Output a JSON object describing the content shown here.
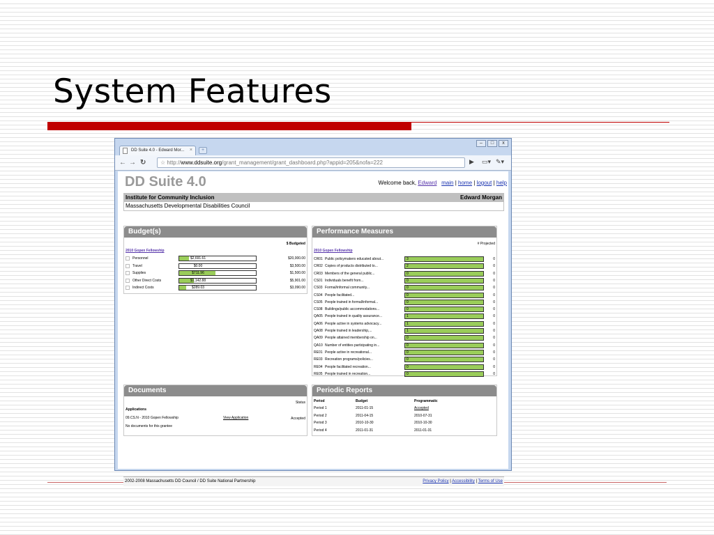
{
  "slide": {
    "title": "System Features"
  },
  "browser": {
    "tab_title": "DD Suite 4.0 - Edward Mor...",
    "tab_close": "×",
    "new_tab": "+",
    "url_prefix": "http://",
    "url_host": "www.ddsuite.org",
    "url_path": "/grant_management/grant_dashboard.php?appid=205&nofa=222",
    "window_buttons": [
      "–",
      "□",
      "x"
    ]
  },
  "header": {
    "logo": "DD Suite 4.0",
    "welcome": "Welcome back,",
    "user": "Edward",
    "links": [
      "main",
      "home",
      "logout",
      "help"
    ],
    "org_name": "Institute for Community Inclusion",
    "org_user": "Edward Morgan",
    "council": "Massachusetts Developmental Disabilities Council"
  },
  "budget": {
    "title": "Budget(s)",
    "column_label": "$ Budgeted",
    "grant": "2010 Gopen Fellowship",
    "rows": [
      {
        "name": "Personnel",
        "spent": "$2,691.61",
        "ratio": 0.13,
        "budgeted": "$20,000.00"
      },
      {
        "name": "Travel",
        "spent": "$0.00",
        "ratio": 0,
        "budgeted": "$3,500.00"
      },
      {
        "name": "Supplies",
        "spent": "$711.96",
        "ratio": 0.47,
        "budgeted": "$1,500.00"
      },
      {
        "name": "Other Direct Costs",
        "spent": "$1,142.88",
        "ratio": 0.19,
        "budgeted": "$5,901.00"
      },
      {
        "name": "Indirect Costs",
        "spent": "$289.03",
        "ratio": 0.09,
        "budgeted": "$3,090.00"
      }
    ]
  },
  "performance": {
    "title": "Performance Measures",
    "column_label": "# Projected",
    "grant": "2010 Gopen Fellowship",
    "rows": [
      {
        "code": "CR01",
        "desc": "Public policymakers educated about...",
        "value": "3",
        "projected": "0"
      },
      {
        "code": "CR02",
        "desc": "Copies of products distributed to...",
        "value": "2",
        "projected": "0"
      },
      {
        "code": "CR03",
        "desc": "Members of the general public...",
        "value": "0",
        "projected": "0"
      },
      {
        "code": "CS01",
        "desc": "Individuals benefit from...",
        "value": "0",
        "projected": "0"
      },
      {
        "code": "CS03",
        "desc": "Formal/informal community...",
        "value": "0",
        "projected": "0"
      },
      {
        "code": "CS04",
        "desc": "People facilitated...",
        "value": "0",
        "projected": "0"
      },
      {
        "code": "CS05",
        "desc": "People trained in formal/informal...",
        "value": "0",
        "projected": "0"
      },
      {
        "code": "CS08",
        "desc": "Buildings/public accommodations...",
        "value": "0",
        "projected": "0"
      },
      {
        "code": "QA05",
        "desc": "People trained in quality assurance...",
        "value": "1",
        "projected": "0"
      },
      {
        "code": "QA06",
        "desc": "People active in systems advocacy...",
        "value": "1",
        "projected": "0"
      },
      {
        "code": "QA08",
        "desc": "People trained in leadership,...",
        "value": "1",
        "projected": "0"
      },
      {
        "code": "QA09",
        "desc": "People attained membership on...",
        "value": "0",
        "projected": "0"
      },
      {
        "code": "QA10",
        "desc": "Number of entities participating in...",
        "value": "0",
        "projected": "0"
      },
      {
        "code": "RE01",
        "desc": "People active in recreational...",
        "value": "0",
        "projected": "0"
      },
      {
        "code": "RE03",
        "desc": "Recreation programs/policies...",
        "value": "0",
        "projected": "0"
      },
      {
        "code": "RE04",
        "desc": "People facilitated recreation...",
        "value": "0",
        "projected": "0"
      },
      {
        "code": "RE05",
        "desc": "People trained in recreation...",
        "value": "0",
        "projected": "0"
      }
    ]
  },
  "documents": {
    "title": "Documents",
    "status_label": "Status",
    "section": "Applications",
    "item": "09.CS.N - 2010 Gopen Fellowship",
    "item_link": "View Application",
    "item_status": "Accepted",
    "empty": "No documents for this grantee"
  },
  "reports": {
    "title": "Periodic Reports",
    "headers": [
      "Period",
      "Budget",
      "Programmatic"
    ],
    "rows": [
      [
        "Period 1",
        "2011-01-15",
        "Accepted"
      ],
      [
        "Period 2",
        "2011-04-15",
        "2010-07-31"
      ],
      [
        "Period 3",
        "2010-10-30",
        "2010-10-30"
      ],
      [
        "Period 4",
        "2011-01-31",
        "2011-01-31"
      ]
    ]
  },
  "footer": {
    "copyright": "2002-2008 Massachusetts DD Council / DD Suite National Partnership",
    "links": [
      "Privacy Policy",
      "Accessibility",
      "Terms of Use"
    ]
  }
}
